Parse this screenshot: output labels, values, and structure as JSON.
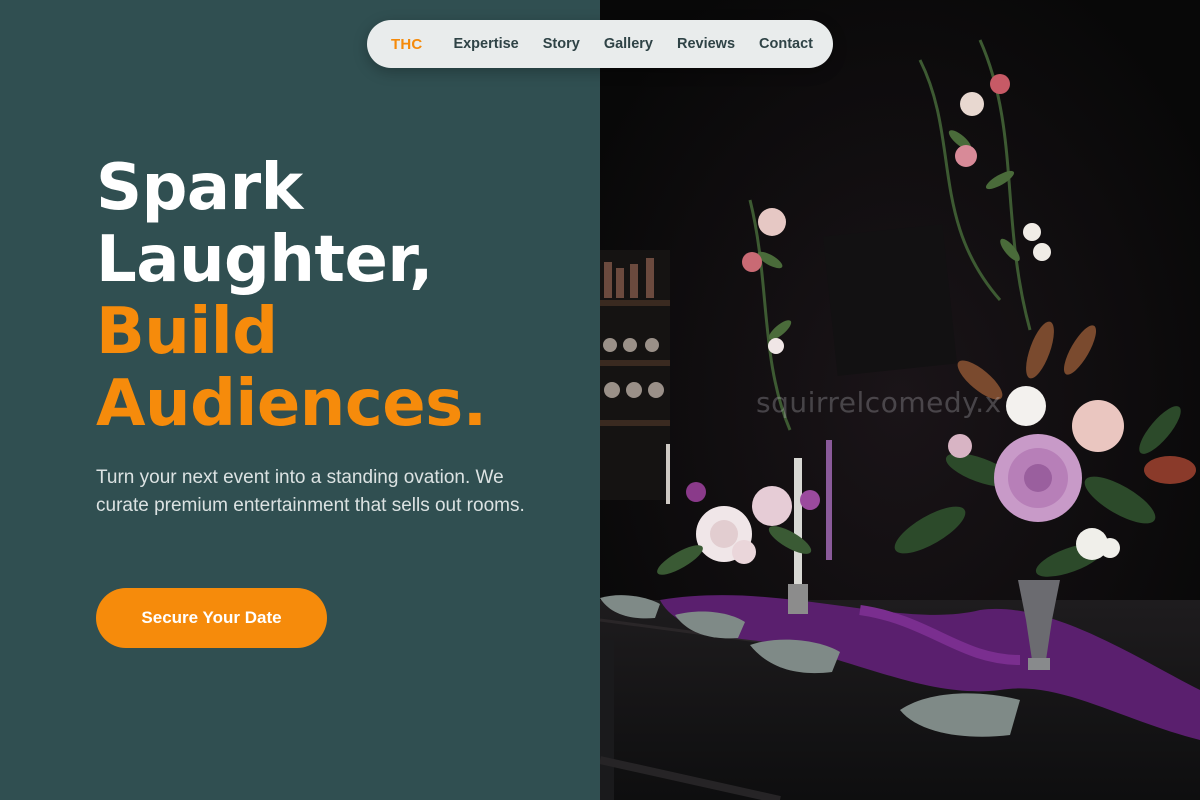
{
  "nav": {
    "brand": "THC",
    "links": [
      "Expertise",
      "Story",
      "Gallery",
      "Reviews",
      "Contact"
    ]
  },
  "hero": {
    "headline_lines": [
      "Spark",
      "Laughter,",
      "Build",
      "Audiences."
    ],
    "subtext": "Turn your next event into a standing ovation. We curate premium entertainment that sells out rooms.",
    "cta_label": "Secure Your Date"
  },
  "image": {
    "watermark": "squirrelcomedy.x"
  },
  "colors": {
    "left_panel_bg": "#304f51",
    "accent_orange": "#f68b0b",
    "nav_bg": "#e9ecec",
    "nav_text": "#2f4346",
    "headline_white": "#ffffff"
  },
  "icons": []
}
